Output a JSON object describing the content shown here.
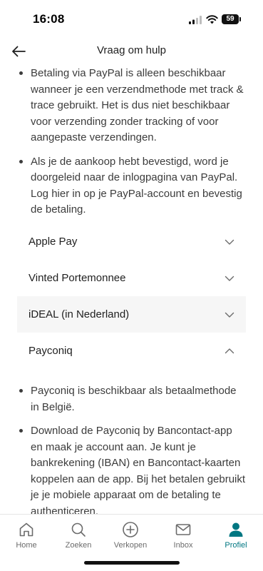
{
  "status_bar": {
    "time": "16:08",
    "battery_level": "59",
    "icons": [
      "cellular-signal-icon",
      "wifi-icon",
      "battery-icon"
    ]
  },
  "header": {
    "title": "Vraag om hulp",
    "back_icon": "arrow-left-icon"
  },
  "paypal_bullets": [
    "Betaling via PayPal is alleen beschikbaar wanneer je een verzendmethode met track & trace gebruikt. Het is dus niet beschikbaar voor verzending zonder tracking of voor aangepaste verzendingen.",
    "Als je de aankoop hebt bevestigd, word je doorgeleid naar de inlogpagina van PayPal. Log hier in op je PayPal-account en bevestig de betaling."
  ],
  "accordion": [
    {
      "label": "Apple Pay",
      "expanded": false,
      "icon": "chevron-down-icon"
    },
    {
      "label": "Vinted Portemonnee",
      "expanded": false,
      "icon": "chevron-down-icon"
    },
    {
      "label": "iDEAL (in Nederland)",
      "expanded": false,
      "icon": "chevron-down-icon"
    },
    {
      "label": "Payconiq",
      "expanded": true,
      "icon": "chevron-up-icon"
    }
  ],
  "payconiq_bullets": [
    "Payconiq is beschikbaar als betaalmethode in België.",
    "Download de Payconiq by Bancontact-app en maak je account aan. Je kunt je bankrekening (IBAN) en Bancontact-kaarten koppelen aan de app. Bij het betalen gebruikt je je mobiele apparaat om de betaling te authenticeren."
  ],
  "tabs": [
    {
      "label": "Home",
      "icon": "home-icon",
      "active": false
    },
    {
      "label": "Zoeken",
      "icon": "search-icon",
      "active": false
    },
    {
      "label": "Verkopen",
      "icon": "plus-circle-icon",
      "active": false
    },
    {
      "label": "Inbox",
      "icon": "mail-icon",
      "active": false
    },
    {
      "label": "Profiel",
      "icon": "profile-icon",
      "active": true
    }
  ],
  "colors": {
    "accent": "#007782",
    "text": "#1f1f1f",
    "body_text": "#3c3c3c",
    "tab_inactive": "#6b6b6b",
    "row_highlight": "#f6f6f6"
  }
}
